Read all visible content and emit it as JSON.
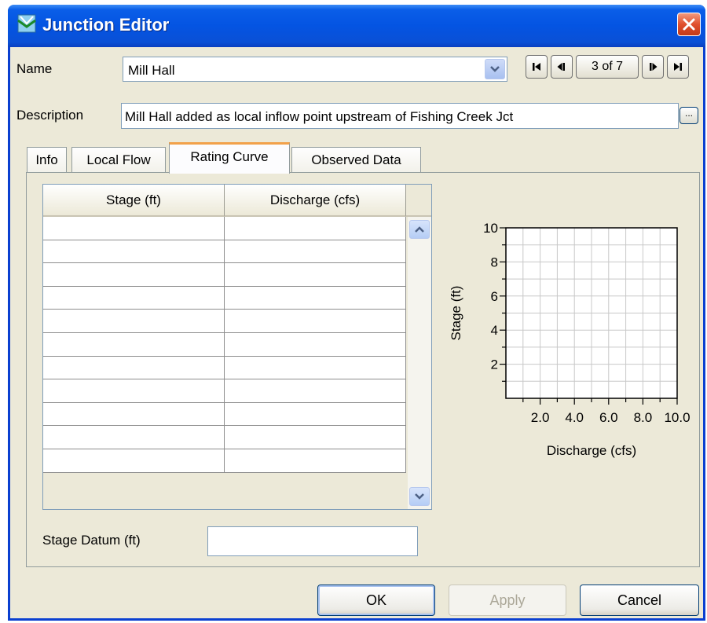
{
  "window": {
    "title": "Junction Editor"
  },
  "form": {
    "name_label": "Name",
    "name_value": "Mill Hall",
    "description_label": "Description",
    "description_value": "Mill Hall added as local inflow point upstream of Fishing Creek Jct",
    "description_more": "...",
    "record_position": "3 of 7"
  },
  "tabs": [
    {
      "label": "Info",
      "active": false
    },
    {
      "label": "Local Flow",
      "active": false
    },
    {
      "label": "Rating Curve",
      "active": true
    },
    {
      "label": "Observed Data",
      "active": false
    }
  ],
  "rating_table": {
    "columns": [
      "Stage (ft)",
      "Discharge (cfs)"
    ],
    "rows": [
      [
        "",
        ""
      ],
      [
        "",
        ""
      ],
      [
        "",
        ""
      ],
      [
        "",
        ""
      ],
      [
        "",
        ""
      ],
      [
        "",
        ""
      ],
      [
        "",
        ""
      ],
      [
        "",
        ""
      ],
      [
        "",
        ""
      ],
      [
        "",
        ""
      ],
      [
        "",
        ""
      ]
    ]
  },
  "stage_datum": {
    "label": "Stage Datum (ft)",
    "value": ""
  },
  "chart_data": {
    "type": "line",
    "title": "",
    "xlabel": "Discharge (cfs)",
    "ylabel": "Stage (ft)",
    "x_ticks": [
      "2.0",
      "4.0",
      "6.0",
      "8.0",
      "10.0"
    ],
    "y_ticks": [
      "2",
      "4",
      "6",
      "8",
      "10"
    ],
    "xlim": [
      0,
      10
    ],
    "ylim": [
      0,
      10
    ],
    "grid": true,
    "series": []
  },
  "buttons": {
    "ok": "OK",
    "apply": "Apply",
    "cancel": "Cancel"
  },
  "colors": {
    "titlebar": "#0454e2",
    "close": "#e0502e",
    "active_tab_accent": "#f2a14a",
    "window_bg": "#ece9d8"
  }
}
